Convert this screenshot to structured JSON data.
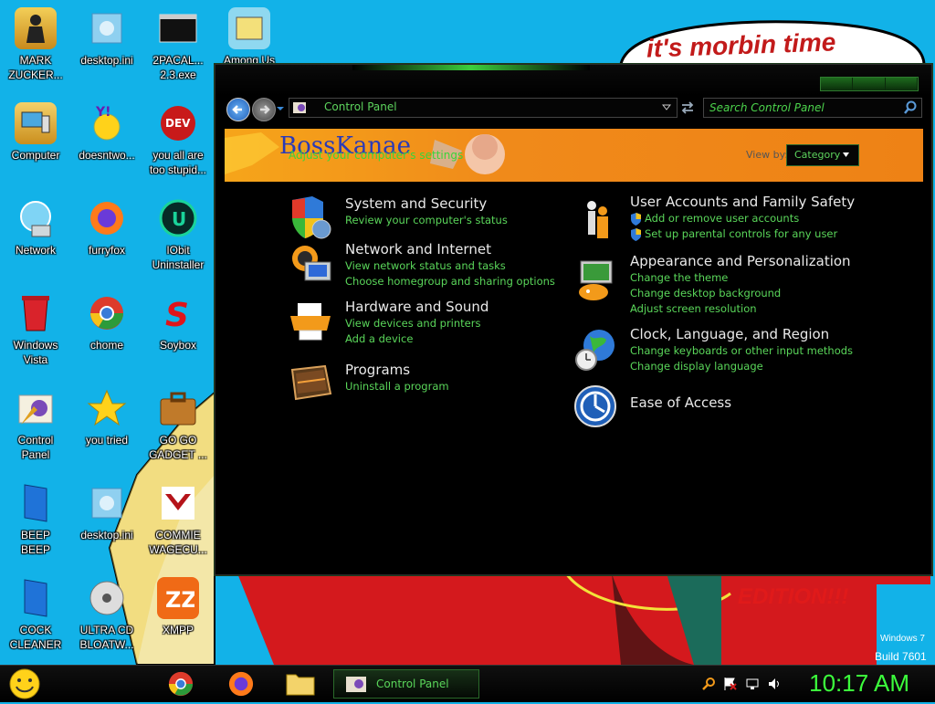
{
  "desktop": {
    "icons": [
      {
        "label": "MARK\nZUCKER...",
        "icon": "user-folder-icon"
      },
      {
        "label": "desktop.ini",
        "icon": "settings-file-icon"
      },
      {
        "label": "2PACAL...\n2.3.exe",
        "icon": "console-exe-icon"
      },
      {
        "label": "Among Us",
        "icon": "game-shortcut-icon"
      },
      {
        "label": "Computer",
        "icon": "computer-icon"
      },
      {
        "label": "doesntwo...",
        "icon": "yahoo-messenger-icon"
      },
      {
        "label": "you all are\ntoo stupid...",
        "icon": "devcpp-icon"
      },
      {
        "label": "Network",
        "icon": "network-globe-icon"
      },
      {
        "label": "furryfox",
        "icon": "firefox-icon"
      },
      {
        "label": "IObit\nUninstaller",
        "icon": "iobit-uninstaller-icon"
      },
      {
        "label": "Windows\nVista",
        "icon": "recycle-bin-icon"
      },
      {
        "label": "chome",
        "icon": "chrome-icon"
      },
      {
        "label": "Soybox",
        "icon": "soybox-icon"
      },
      {
        "label": "Control\nPanel",
        "icon": "control-panel-icon"
      },
      {
        "label": "you tried",
        "icon": "star-icon"
      },
      {
        "label": "GO GO\nGADGET ...",
        "icon": "briefcase-icon"
      },
      {
        "label": "BEEP\nBEEP",
        "icon": "blue-book-icon"
      },
      {
        "label": "desktop.ini",
        "icon": "settings-file-icon"
      },
      {
        "label": "COMMIE\nWAGECU...",
        "icon": "emblem-icon"
      },
      {
        "label": "COCK\nCLEANER",
        "icon": "blue-book-icon"
      },
      {
        "label": "ULTRA CD\nBLOATW...",
        "icon": "cd-burner-icon"
      },
      {
        "label": "XMPP",
        "icon": "xampp-icon"
      }
    ],
    "speech_bubble": "it's morbin time",
    "wallpaper_caption": "EDITION!!!",
    "watermark_windows": "Windows 7",
    "watermark_build": "Build 7601"
  },
  "window": {
    "address": "Control Panel",
    "search_placeholder": "Search Control Panel",
    "banner_logo": "BossKanae",
    "banner_subtitle": "Adjust your computer's settings",
    "view_by_label": "View by:",
    "view_by_value": "Category",
    "categories_left": [
      {
        "title": "System and Security",
        "icon": "shield-icon",
        "links": [
          "Review your computer's status"
        ]
      },
      {
        "title": "Network and Internet",
        "icon": "network-globe-icon",
        "links": [
          "View network status and tasks",
          "Choose homegroup and sharing options"
        ]
      },
      {
        "title": "Hardware and Sound",
        "icon": "printer-icon",
        "links": [
          "View devices and printers",
          "Add a device"
        ]
      },
      {
        "title": "Programs",
        "icon": "programs-icon",
        "links": [
          "Uninstall a program"
        ]
      }
    ],
    "categories_right": [
      {
        "title": "User Accounts and Family Safety",
        "icon": "users-icon",
        "links": [
          "Add or remove user accounts",
          "Set up parental controls for any user"
        ]
      },
      {
        "title": "Appearance and Personalization",
        "icon": "paint-palette-icon",
        "links": [
          "Change the theme",
          "Change desktop background",
          "Adjust screen resolution"
        ]
      },
      {
        "title": "Clock, Language, and Region",
        "icon": "clock-globe-icon",
        "links": [
          "Change keyboards or other input methods",
          "Change display language"
        ]
      },
      {
        "title": "Ease of Access",
        "icon": "accessibility-icon",
        "links": []
      }
    ]
  },
  "taskbar": {
    "active_window_label": "Control Panel",
    "clock": "10:17 AM"
  },
  "colors": {
    "accent_green": "#5ad65a",
    "banner_orange": "#f08a1a",
    "desktop_blue": "#12b2e8"
  }
}
